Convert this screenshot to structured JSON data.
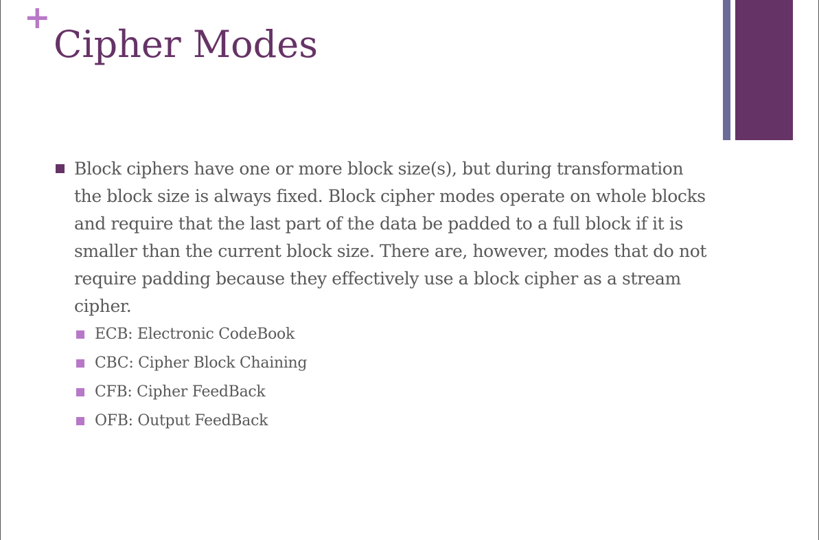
{
  "slide": {
    "plus_symbol": "+",
    "title": "Cipher Modes",
    "bullet_main": "Block ciphers have one or more block size(s), but during transformation the block size is always fixed. Block cipher modes operate on whole blocks and require that the last part of the data be padded to a full block if it is smaller than the current block size. There are, however, modes that do not require padding because they effectively use a block cipher as a stream cipher.",
    "sub_bullets": [
      {
        "label": "ECB: Electronic CodeBook"
      },
      {
        "label": "CBC: Cipher Block Chaining"
      },
      {
        "label": "CFB: Cipher FeedBack"
      },
      {
        "label": "OFB: Output FeedBack"
      }
    ]
  },
  "colors": {
    "title": "#663366",
    "accent_plus": "#b878c8",
    "main_bullet": "#663366",
    "sub_bullet": "#b878c8",
    "stripe_thin": "#6b6b99",
    "stripe_thick": "#663366",
    "body_text": "#595959"
  }
}
